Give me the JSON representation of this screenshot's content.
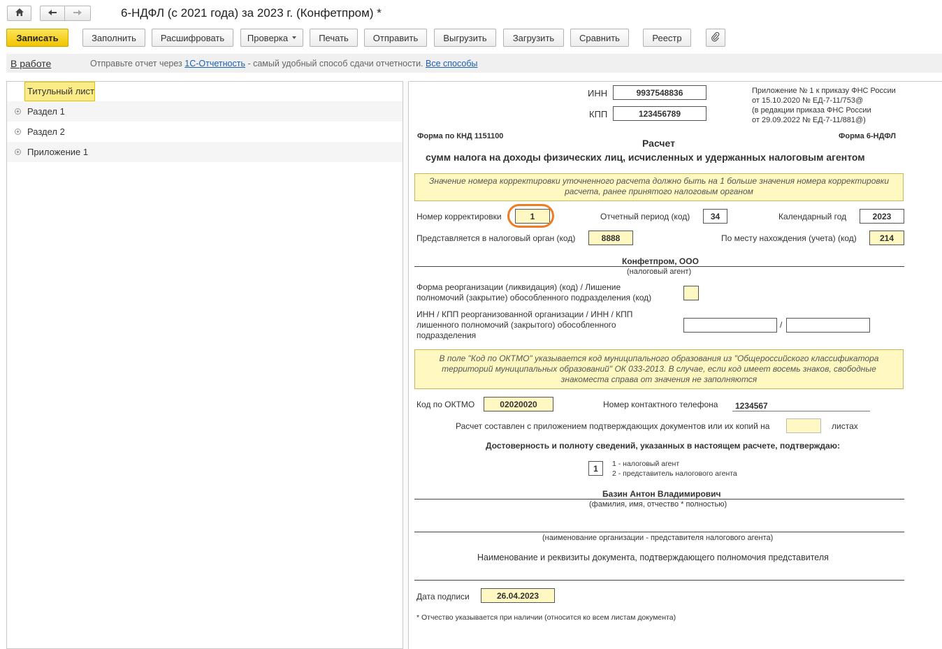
{
  "window": {
    "title": "6-НДФЛ (с 2021 года) за 2023 г. (Конфетпром) *"
  },
  "nav": {
    "home": "home-icon",
    "back": "arrow-left-icon",
    "forward": "arrow-right-icon"
  },
  "toolbar": {
    "save": "Записать",
    "fill": "Заполнить",
    "decode": "Расшифровать",
    "check": "Проверка",
    "print": "Печать",
    "send": "Отправить",
    "export": "Выгрузить",
    "import": "Загрузить",
    "compare": "Сравнить",
    "registry": "Реестр",
    "attach": "paperclip-icon"
  },
  "infobar": {
    "status": "В работе",
    "text_before": "Отправьте отчет через",
    "link1": "1С-Отчетность",
    "text_after": "- самый удобный способ сдачи отчетности.",
    "link2": "Все способы"
  },
  "tree": {
    "items": [
      {
        "label": "Титульный лист",
        "selected": true
      },
      {
        "label": "Раздел 1"
      },
      {
        "label": "Раздел 2"
      },
      {
        "label": "Приложение 1"
      }
    ]
  },
  "form": {
    "inn_label": "ИНН",
    "inn": "9937548836",
    "kpp_label": "КПП",
    "kpp": "123456789",
    "order_ref": [
      "Приложение № 1 к приказу ФНС России",
      "от 15.10.2020 № ЕД-7-11/753@",
      "(в редакции приказа ФНС России",
      "от 29.09.2022 № ЕД-7-11/881@)"
    ],
    "knd": "Форма по КНД 1151100",
    "form_name": "Форма 6-НДФЛ",
    "title1": "Расчет",
    "title2": "сумм налога на доходы физических лиц, исчисленных и удержанных налоговым агентом",
    "note1": "Значение номера корректировки уточненного расчета должно быть на 1 больше значения номера корректировки расчета, ранее принятого налоговым органом",
    "correction_label": "Номер корректировки",
    "correction": "1",
    "period_label": "Отчетный период (код)",
    "period": "34",
    "year_label": "Календарный год",
    "year": "2023",
    "tax_org_label": "Представляется в налоговый орган (код)",
    "tax_org": "8888",
    "location_label": "По месту нахождения (учета) (код)",
    "location": "214",
    "agent_name": "Конфетпром, ООО",
    "agent_caption": "(налоговый агент)",
    "reorg_label": "Форма реорганизации (ликвидация) (код) / Лишение полномочий (закрытие) обособленного подразделения (код)",
    "reorg_value": "",
    "reorg_inn_label": "ИНН / КПП реорганизованной организации / ИНН / КПП лишенного полномочий (закрытого) обособленного подразделения",
    "reorg_inn": "",
    "reorg_kpp": "",
    "slash": "/",
    "note2": "В поле \"Код по ОКТМО\" указывается код муниципального образования из \"Общероссийского классификатора территорий муниципальных образований\" ОК 033-2013. В случае, если код имеет восемь знаков, свободные знакоместа справа от значения не заполняются",
    "oktmo_label": "Код по ОКТМО",
    "oktmo": "02020020",
    "phone_label": "Номер контактного телефона",
    "phone": "1234567",
    "pages_label": "Расчет составлен с приложением подтверждающих документов или их копий на",
    "pages": "",
    "pages_suffix": "листах",
    "confirm_heading": "Достоверность и полноту сведений, указанных в настоящем расчете, подтверждаю:",
    "signer_code": "1",
    "signer_opt1": "1 - налоговый агент",
    "signer_opt2": "2 - представитель налогового агента",
    "signer_name": "Базин Антон Владимирович",
    "signer_caption": "(фамилия, имя, отчество * полностью)",
    "rep_caption": "(наименование организации - представителя налогового агента)",
    "doc_label": "Наименование и реквизиты документа, подтверждающего полномочия представителя",
    "sign_date_label": "Дата подписи",
    "sign_date": "26.04.2023",
    "footnote": "* Отчество указывается при наличии (относится ко всем листам документа)"
  },
  "colors": {
    "primary_button": "#f5cd0a",
    "field_yellow": "#fff8c2",
    "highlight_ring": "#f07b22",
    "link": "#1a5fb4"
  }
}
